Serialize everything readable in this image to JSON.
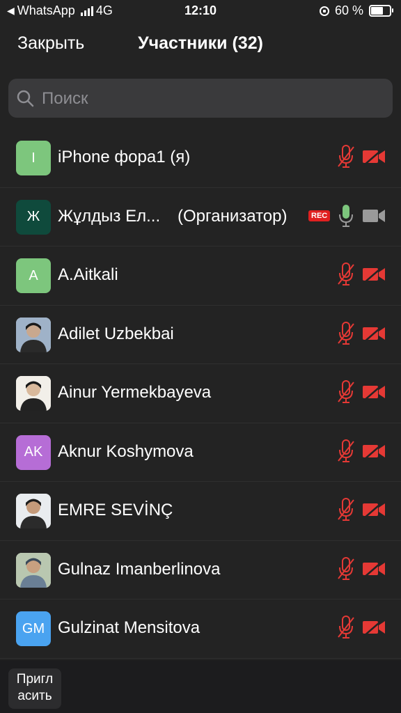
{
  "status_bar": {
    "back_app": "WhatsApp",
    "network": "4G",
    "time": "12:10",
    "battery": "60 %"
  },
  "header": {
    "close_label": "Закрыть",
    "title": "Участники (32)"
  },
  "search": {
    "placeholder": "Поиск"
  },
  "participants": [
    {
      "name": "iPhone фора1 (я)",
      "avatar_text": "I",
      "avatar_color": "#7dc67d",
      "mic": "muted",
      "video": "off"
    },
    {
      "name": "Жұлдыз Ел...",
      "role": "(Организатор)",
      "rec": "REC",
      "avatar_text": "Ж",
      "avatar_color": "#0f4a3c",
      "mic": "on",
      "video": "on"
    },
    {
      "name": "A.Aitkali",
      "avatar_text": "A",
      "avatar_color": "#7dc67d",
      "mic": "muted",
      "video": "off"
    },
    {
      "name": "Adilet Uzbekbai",
      "avatar": "photo",
      "mic": "muted",
      "video": "off"
    },
    {
      "name": "Ainur Yermekbayeva",
      "avatar": "photo",
      "mic": "muted",
      "video": "off"
    },
    {
      "name": "Aknur Koshymova",
      "avatar_text": "AK",
      "avatar_color": "#b66dd6",
      "mic": "muted",
      "video": "off"
    },
    {
      "name": "EMRE SEVİNÇ",
      "avatar": "photo",
      "mic": "muted",
      "video": "off"
    },
    {
      "name": "Gulnaz Imanberlinova",
      "avatar": "photo",
      "mic": "muted",
      "video": "off"
    },
    {
      "name": "Gulzinat Mensitova",
      "avatar_text": "GM",
      "avatar_color": "#4aa3f0",
      "mic": "muted",
      "video": "off"
    }
  ],
  "footer": {
    "invite_label": "Пригл асить"
  },
  "colors": {
    "muted": "#e53935",
    "active_mic": "#7dc67d",
    "active_cam": "#9a9a9a",
    "background": "#232323"
  }
}
